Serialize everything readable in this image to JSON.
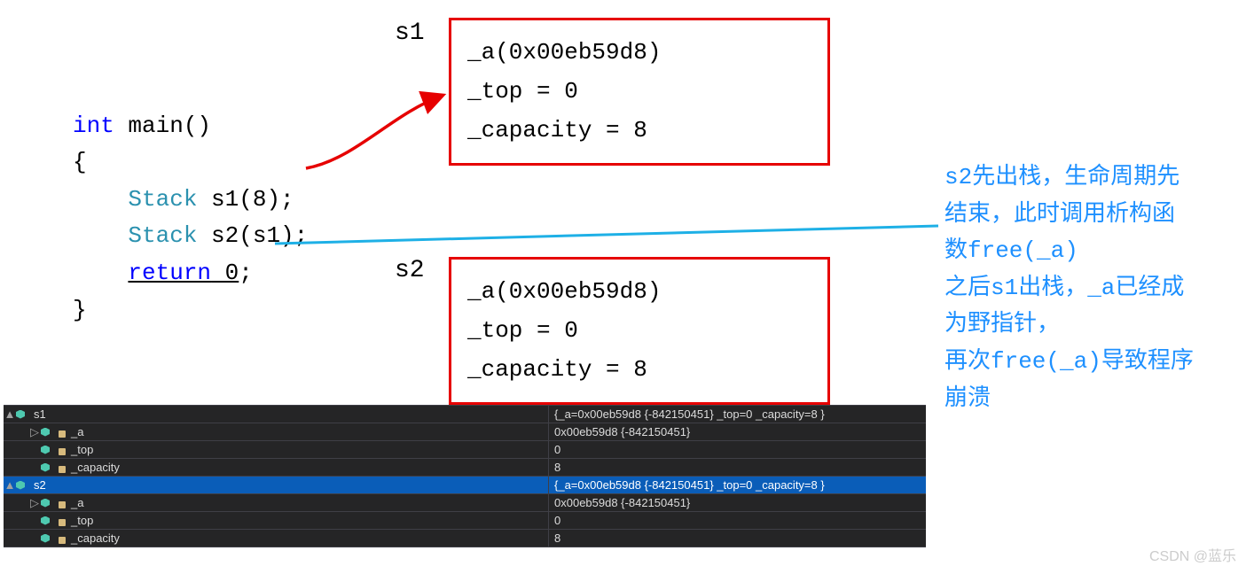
{
  "code": {
    "line1_kw": "int",
    "line1_rest": " main()",
    "line2": "{",
    "line3_type": "Stack",
    "line3_rest": " s1(8);",
    "line4_type": "Stack",
    "line4_rest": " s2(s1);",
    "line5_kw": "return",
    "line5_rest": " 0",
    "line5_semi": ";",
    "line6": "}"
  },
  "boxes": {
    "s1": {
      "label": "s1",
      "a": "_a(0x00eb59d8)",
      "top": "_top = 0",
      "capacity": "_capacity = 8"
    },
    "s2": {
      "label": "s2",
      "a": "_a(0x00eb59d8)",
      "top": "_top = 0",
      "capacity": "_capacity = 8"
    }
  },
  "annotation": {
    "l1": "s2先出栈，生命周期先",
    "l2": "结束，此时调用析构函",
    "l3": "数free(_a)",
    "l4": "之后s1出栈，_a已经成",
    "l5": "为野指针，",
    "l6": "再次free(_a)导致程序",
    "l7": "崩溃"
  },
  "debugger": {
    "rows": [
      {
        "depth": 0,
        "expand": "▲",
        "icon": "struct",
        "name": "s1",
        "value": "{_a=0x00eb59d8 {-842150451} _top=0 _capacity=8 }",
        "sel": false
      },
      {
        "depth": 1,
        "expand": "▷",
        "icon": "field",
        "name": "_a",
        "value": "0x00eb59d8 {-842150451}",
        "sel": false
      },
      {
        "depth": 1,
        "expand": "",
        "icon": "field",
        "name": "_top",
        "value": "0",
        "sel": false
      },
      {
        "depth": 1,
        "expand": "",
        "icon": "field",
        "name": "_capacity",
        "value": "8",
        "sel": false
      },
      {
        "depth": 0,
        "expand": "▲",
        "icon": "struct",
        "name": "s2",
        "value": "{_a=0x00eb59d8 {-842150451} _top=0 _capacity=8 }",
        "sel": true
      },
      {
        "depth": 1,
        "expand": "▷",
        "icon": "field",
        "name": "_a",
        "value": "0x00eb59d8 {-842150451}",
        "sel": false
      },
      {
        "depth": 1,
        "expand": "",
        "icon": "field",
        "name": "_top",
        "value": "0",
        "sel": false
      },
      {
        "depth": 1,
        "expand": "",
        "icon": "field",
        "name": "_capacity",
        "value": "8",
        "sel": false
      }
    ]
  },
  "watermark": "CSDN @蓝乐",
  "chart_data": {
    "type": "diagram",
    "description": "C++ shallow-copy double-free illustration: main() constructs Stack s1(8) then copy-constructs s2 from s1; both share _a pointer; destructors free same pointer twice causing crash.",
    "objects": {
      "s1": {
        "_a": "0x00eb59d8",
        "_top": 0,
        "_capacity": 8
      },
      "s2": {
        "_a": "0x00eb59d8",
        "_top": 0,
        "_capacity": 8
      }
    },
    "debugger_snapshot": [
      {
        "var": "s1",
        "value": "{_a=0x00eb59d8 {-842150451} _top=0 _capacity=8 }"
      },
      {
        "var": "s1._a",
        "value": "0x00eb59d8 {-842150451}"
      },
      {
        "var": "s1._top",
        "value": 0
      },
      {
        "var": "s1._capacity",
        "value": 8
      },
      {
        "var": "s2",
        "value": "{_a=0x00eb59d8 {-842150451} _top=0 _capacity=8 }"
      },
      {
        "var": "s2._a",
        "value": "0x00eb59d8 {-842150451}"
      },
      {
        "var": "s2._top",
        "value": 0
      },
      {
        "var": "s2._capacity",
        "value": 8
      }
    ]
  }
}
